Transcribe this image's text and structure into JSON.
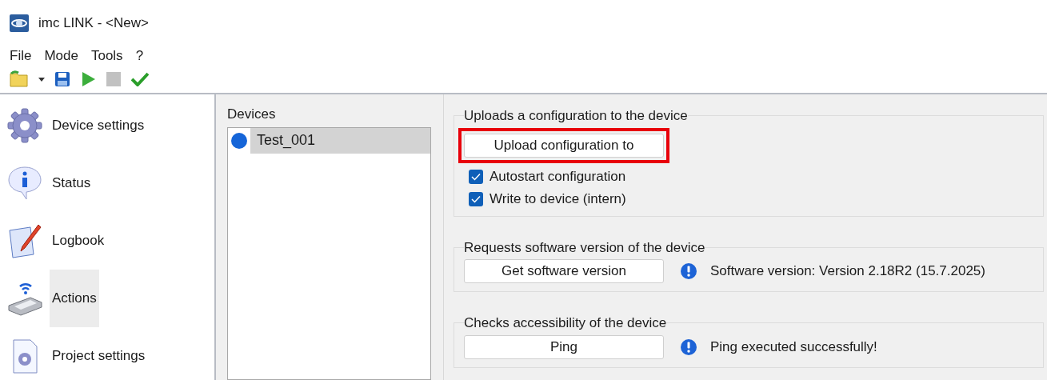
{
  "window": {
    "title": "imc LINK - <New>"
  },
  "menu": [
    "File",
    "Mode",
    "Tools",
    "?"
  ],
  "toolbar": [
    {
      "kind": "open"
    },
    {
      "kind": "dropdown"
    },
    {
      "kind": "save"
    },
    {
      "kind": "start",
      "disabled": false
    },
    {
      "kind": "stop",
      "disabled": true
    },
    {
      "kind": "check",
      "disabled": false
    }
  ],
  "sidebar": {
    "items": [
      {
        "label": "Device settings",
        "kind": "gear",
        "selected": false
      },
      {
        "label": "Status",
        "kind": "info",
        "selected": false
      },
      {
        "label": "Logbook",
        "kind": "logbook",
        "selected": false
      },
      {
        "label": "Actions",
        "kind": "device",
        "selected": true
      },
      {
        "label": "Project settings",
        "kind": "project",
        "selected": false
      }
    ]
  },
  "devices": {
    "title": "Devices",
    "items": [
      {
        "label": "Test_001",
        "color": "#1565d8",
        "selected": true
      }
    ]
  },
  "actions": [
    {
      "title": "Uploads a configuration to the device",
      "button": "Upload configuration to",
      "highlighted": true,
      "checkboxes": [
        {
          "label": "Autostart configuration",
          "checked": true
        },
        {
          "label": "Write to device (intern)",
          "checked": true
        }
      ]
    },
    {
      "title": "Requests software version of the device",
      "button": "Get software version",
      "highlighted": false,
      "message": "Software version: Version 2.18R2 (15.7.2025)"
    },
    {
      "title": "Checks accessibility of the device",
      "button": "Ping",
      "highlighted": false,
      "message": "Ping executed successfully!"
    }
  ]
}
